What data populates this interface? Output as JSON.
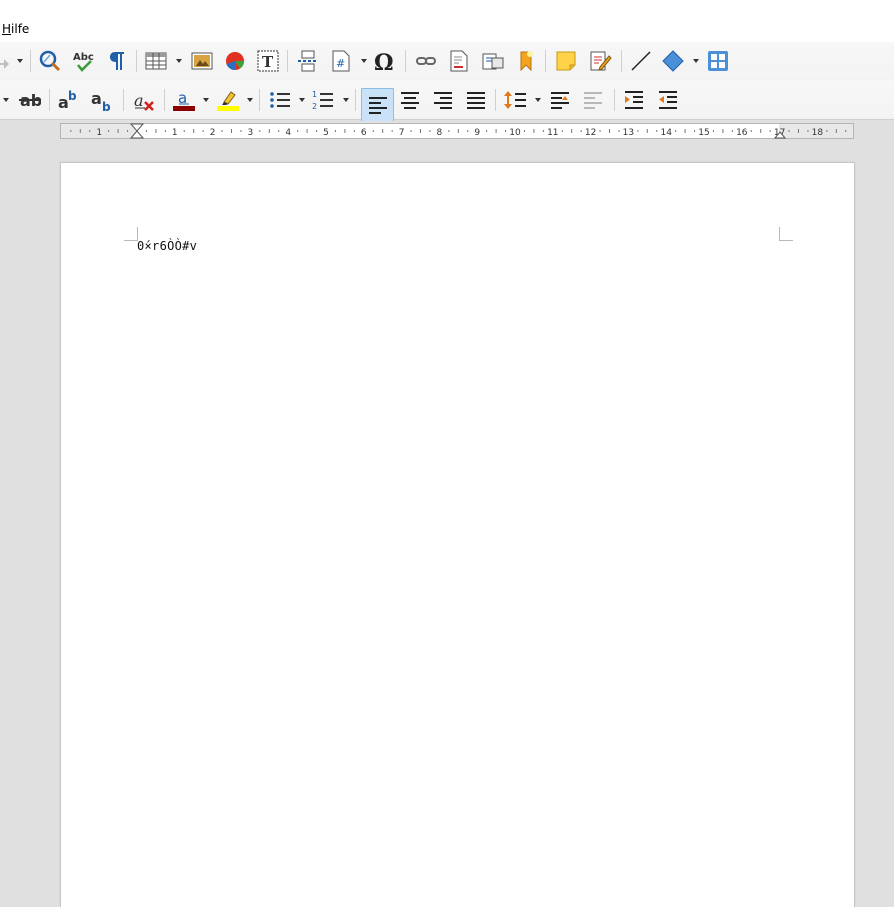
{
  "menu": {
    "help_label": "Hilfe"
  },
  "document": {
    "text": "0́×r6ÒÒ#v"
  },
  "ruler": {
    "numbers": [
      "1",
      "1",
      "2",
      "3",
      "4",
      "5",
      "6",
      "7",
      "8",
      "9",
      "10",
      "11",
      "12",
      "13",
      "14",
      "15",
      "16",
      "17",
      "18"
    ]
  },
  "toolbar_standard": {
    "icons": [
      "redo-icon",
      "find-replace-icon",
      "spelling-icon",
      "formatting-marks-icon",
      "table-icon",
      "image-icon",
      "chart-icon",
      "text-box-icon",
      "page-break-icon",
      "field-icon",
      "special-character-icon",
      "hyperlink-icon",
      "footnote-icon",
      "endnote-icon",
      "bookmark-icon",
      "comment-icon",
      "track-changes-icon",
      "line-icon",
      "basic-shapes-icon",
      "draw-functions-icon"
    ]
  },
  "toolbar_formatting": {
    "icons": [
      "strikethrough-icon",
      "superscript-icon",
      "subscript-icon",
      "clear-formatting-icon",
      "font-color-icon",
      "highlight-icon",
      "unordered-list-icon",
      "ordered-list-icon",
      "align-left-icon",
      "align-center-icon",
      "align-right-icon",
      "justify-icon",
      "line-spacing-icon",
      "increase-paragraph-spacing-icon",
      "decrease-paragraph-spacing-icon",
      "increase-indent-icon",
      "decrease-indent-icon"
    ]
  },
  "colors": {
    "font_color": "#8b0000",
    "highlight_color": "#ffff00",
    "active_button": "#c9e2f7",
    "page": "#ffffff",
    "workspace": "#e0e0e0"
  }
}
